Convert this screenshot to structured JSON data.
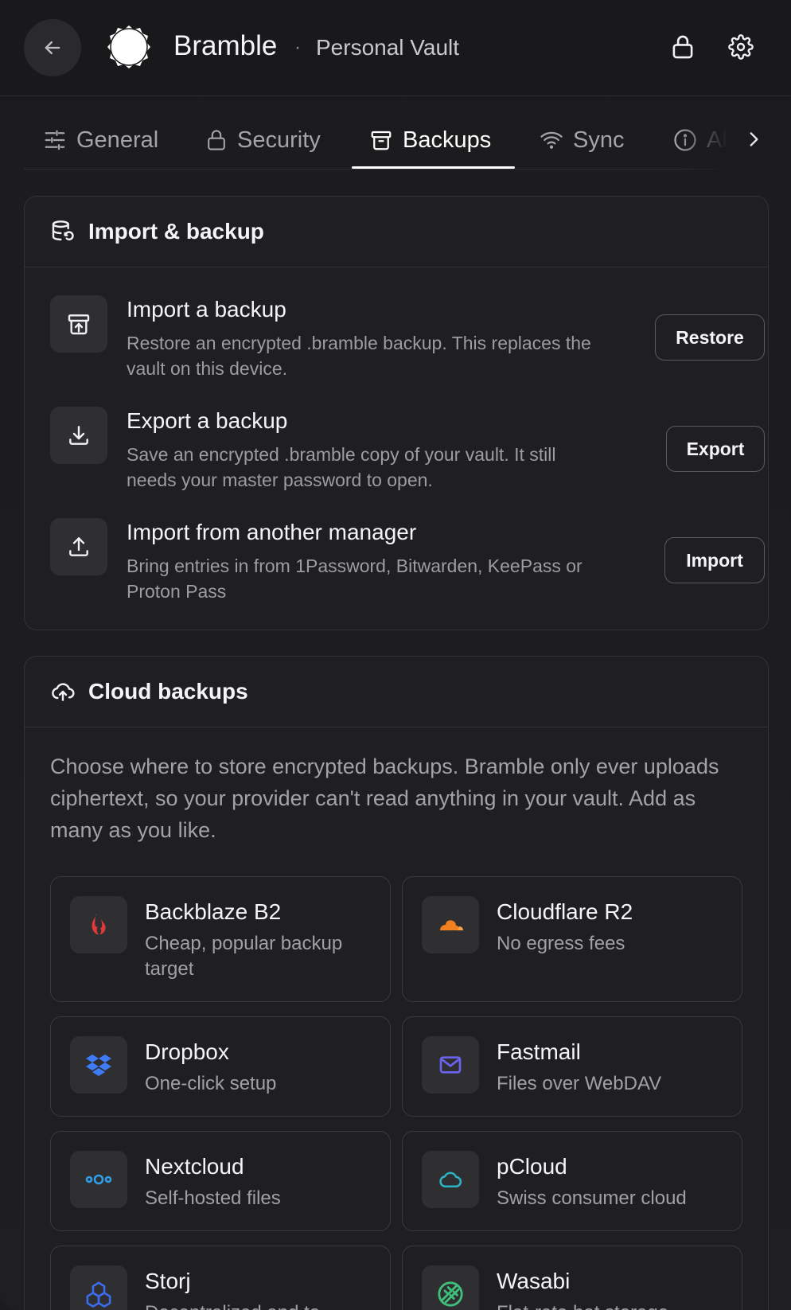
{
  "header": {
    "app_name": "Bramble",
    "separator": "·",
    "vault_name": "Personal Vault"
  },
  "tabs": [
    {
      "label": "General",
      "icon": "sliders-icon"
    },
    {
      "label": "Security",
      "icon": "lock-icon"
    },
    {
      "label": "Backups",
      "icon": "archive-icon",
      "active": true
    },
    {
      "label": "Sync",
      "icon": "wifi-icon"
    },
    {
      "label": "Ab",
      "icon": "info-icon"
    }
  ],
  "import_backup": {
    "title": "Import & backup",
    "rows": [
      {
        "title": "Import a backup",
        "description": "Restore an encrypted .bramble backup. This replaces the vault on this device.",
        "button": "Restore"
      },
      {
        "title": "Export a backup",
        "description": "Save an encrypted .bramble copy of your vault. It still needs your master password to open.",
        "button": "Export"
      },
      {
        "title": "Import from another manager",
        "description": "Bring entries in from 1Password, Bitwarden, KeePass or Proton Pass",
        "button": "Import"
      }
    ]
  },
  "cloud_backups": {
    "title": "Cloud backups",
    "intro": "Choose where to store encrypted backups. Bramble only ever uploads ciphertext, so your provider can't read anything in your vault. Add as many as you like.",
    "providers": [
      {
        "name": "Backblaze B2",
        "description": "Cheap, popular backup target",
        "icon": "backblaze-flame-icon",
        "color": "#e0383b"
      },
      {
        "name": "Cloudflare R2",
        "description": "No egress fees",
        "icon": "cloudflare-cloud-icon",
        "color": "#f38020"
      },
      {
        "name": "Dropbox",
        "description": "One-click setup",
        "icon": "dropbox-icon",
        "color": "#3d7bf7"
      },
      {
        "name": "Fastmail",
        "description": "Files over WebDAV",
        "icon": "mail-icon",
        "color": "#6b63f0"
      },
      {
        "name": "Nextcloud",
        "description": "Self-hosted files",
        "icon": "nextcloud-icon",
        "color": "#2f9ee8"
      },
      {
        "name": "pCloud",
        "description": "Swiss consumer cloud",
        "icon": "cloud-outline-icon",
        "color": "#2bb3c8"
      },
      {
        "name": "Storj",
        "description": "Decentralized and to",
        "icon": "storj-cubes-icon",
        "color": "#3c6cf0"
      },
      {
        "name": "Wasabi",
        "description": "Flat-rate hot storage",
        "icon": "wasabi-leaf-icon",
        "color": "#3fc07a"
      }
    ]
  }
}
